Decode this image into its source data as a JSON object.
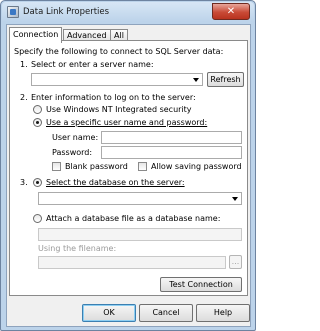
{
  "window": {
    "title": "Data Link Properties",
    "close_glyph": "✕",
    "icon": "data-link-icon"
  },
  "tabs": [
    {
      "label": "Connection",
      "active": true
    },
    {
      "label": "Advanced",
      "active": false
    },
    {
      "label": "All",
      "active": false
    }
  ],
  "connection": {
    "intro": "Specify the following to connect to SQL Server data:",
    "step1": {
      "number": "1.",
      "label": "Select or enter a server name:",
      "server_value": "",
      "refresh_button": "Refresh"
    },
    "step2": {
      "number": "2.",
      "label": "Enter information to log on to the server:",
      "option_windows": "Use Windows NT Integrated security",
      "option_specific": "Use a specific user name and password:",
      "selected": "specific",
      "user_name_label": "User name:",
      "user_name_value": "",
      "password_label": "Password:",
      "password_value": "",
      "blank_password": {
        "label": "Blank password",
        "checked": false
      },
      "allow_saving": {
        "label": "Allow saving password",
        "checked": false
      }
    },
    "step3": {
      "number": "3.",
      "option_select_db": "Select the database on the server:",
      "database_value": "",
      "option_attach": "Attach a database file as a database name:",
      "attach_value": "",
      "using_filename_label": "Using the filename:",
      "filename_value": "",
      "browse_button": "...",
      "selected": "select_db"
    },
    "test_button": "Test Connection"
  },
  "footer": {
    "ok": "OK",
    "cancel": "Cancel",
    "help": "Help"
  }
}
